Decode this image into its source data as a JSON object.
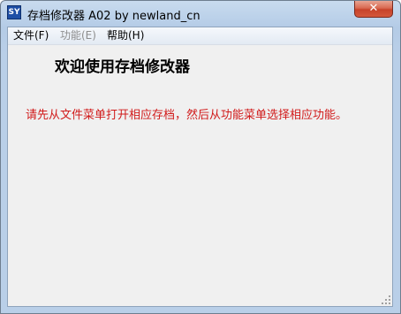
{
  "window": {
    "title": "存档修改器 A02 by newland_cn",
    "app_icon_text": "SY",
    "close_symbol": "✕"
  },
  "menu": {
    "items": [
      {
        "label": "文件(F)",
        "enabled": true
      },
      {
        "label": "功能(E)",
        "enabled": false
      },
      {
        "label": "帮助(H)",
        "enabled": true
      }
    ]
  },
  "content": {
    "welcome": "欢迎使用存档修改器",
    "instruction": "请先从文件菜单打开相应存档，然后从功能菜单选择相应功能。"
  },
  "colors": {
    "instruction_text": "#d11a1a",
    "disabled_menu_text": "#8d8d8d",
    "close_button": "#c7432a"
  }
}
